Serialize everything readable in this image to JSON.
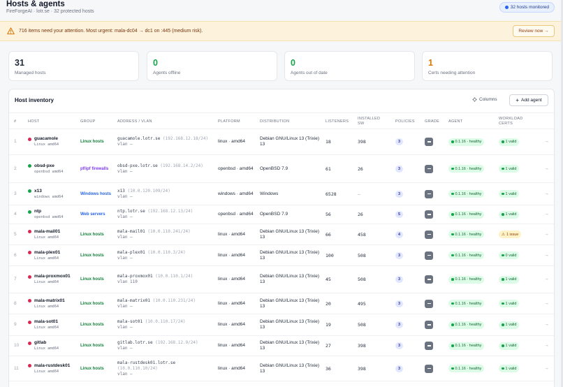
{
  "header": {
    "title": "Hosts & agents",
    "subtitle": "FireForgeAI · lotr.se · 32 protected hosts",
    "badge": "32 hosts monitored"
  },
  "alert": {
    "text": "716 items need your attention. Most urgent: mala-dc04 → dc1 on :445 (medium risk).",
    "button": "Review now →"
  },
  "stats": [
    {
      "value": "31",
      "label": "Managed hosts",
      "color": "#111827"
    },
    {
      "value": "0",
      "label": "Agents offline",
      "color": "#16a34a"
    },
    {
      "value": "0",
      "label": "Agents out of date",
      "color": "#16a34a"
    },
    {
      "value": "1",
      "label": "Certs needing attention",
      "color": "#d97706"
    }
  ],
  "table": {
    "title": "Host inventory",
    "columns_button": "Columns",
    "add_button": "Add agent",
    "headers": {
      "idx": "#",
      "host": "Host",
      "group": "Group",
      "address": "Address / VLAN",
      "platform": "Platform",
      "distribution": "Distribution",
      "listeners": "Listeners",
      "installed": "Installed SW",
      "policies": "Policies",
      "grade": "Grade",
      "agent": "Agent",
      "workload": "Workload certs"
    },
    "rows": [
      {
        "idx": "1",
        "name": "guacamole",
        "meta": "Linux amd64",
        "status": "red",
        "group": "Linux hosts",
        "group_color": "green",
        "fqdn": "guacamole.lotr.se",
        "ip": "(192.168.12.18/24)",
        "vlan": "vlan —",
        "platform": "linux · amd64",
        "dist": "Debian GNU/Linux 13 (Trixie) 13",
        "listeners": "18",
        "sw": "398",
        "policies": "3",
        "agent": "0.1.16 · healthy",
        "work": "1 valid",
        "work_kind": "valid"
      },
      {
        "idx": "2",
        "name": "obsd-pxe",
        "meta": "openbsd amd64",
        "status": "green",
        "group": "pf/ipf firewalls",
        "group_color": "purple",
        "fqdn": "obsd-pxe.lotr.se",
        "ip": "(192.168.14.2/24)",
        "vlan": "vlan —",
        "platform": "openbsd · amd64",
        "dist": "OpenBSD 7.9",
        "listeners": "61",
        "sw": "26",
        "policies": "3",
        "agent": "0.1.16 · healthy",
        "work": "1 valid",
        "work_kind": "valid"
      },
      {
        "idx": "3",
        "name": "x13",
        "meta": "windows amd64",
        "status": "green",
        "group": "Windows hosts",
        "group_color": "blue",
        "fqdn": "x13",
        "ip": "(10.0.120.109/24)",
        "vlan": "vlan —",
        "platform": "windows · amd64",
        "dist": "Windows",
        "listeners": "6528",
        "sw": "—",
        "policies": "3",
        "agent": "0.1.16 · healthy",
        "work": "1 valid",
        "work_kind": "valid"
      },
      {
        "idx": "4",
        "name": "ntp",
        "meta": "openbsd amd64",
        "status": "green",
        "group": "Web servers",
        "group_color": "blue",
        "fqdn": "ntp.lotr.se",
        "ip": "(192.168.12.13/24)",
        "vlan": "vlan —",
        "platform": "openbsd · amd64",
        "dist": "OpenBSD 7.9",
        "listeners": "56",
        "sw": "26",
        "policies": "5",
        "agent": "0.1.16 · healthy",
        "work": "1 valid",
        "work_kind": "valid"
      },
      {
        "idx": "5",
        "name": "mala-mail01",
        "meta": "Linux amd64",
        "status": "red",
        "group": "Linux hosts",
        "group_color": "green",
        "fqdn": "mala-mail01",
        "ip": "(10.0.110.241/24)",
        "vlan": "vlan —",
        "platform": "linux · amd64",
        "dist": "Debian GNU/Linux 13 (Trixie) 13",
        "listeners": "66",
        "sw": "458",
        "policies": "4",
        "agent": "0.1.16 · healthy",
        "work": "1 issue",
        "work_kind": "issue"
      },
      {
        "idx": "6",
        "name": "mala-plex01",
        "meta": "Linux amd64",
        "status": "red",
        "group": "Linux hosts",
        "group_color": "green",
        "fqdn": "mala-plex01",
        "ip": "(10.0.110.3/24)",
        "vlan": "vlan —",
        "platform": "linux · amd64",
        "dist": "Debian GNU/Linux 13 (Trixie) 13",
        "listeners": "100",
        "sw": "508",
        "policies": "3",
        "agent": "0.1.16 · healthy",
        "work": "0 valid",
        "work_kind": "valid"
      },
      {
        "idx": "7",
        "name": "mala-proxmox01",
        "meta": "Linux amd64",
        "status": "red",
        "group": "Linux hosts",
        "group_color": "green",
        "fqdn": "mala-proxmox01",
        "ip": "(10.0.110.1/24)",
        "vlan": "vlan 110",
        "platform": "linux · amd64",
        "dist": "Debian GNU/Linux 13 (Trixie) 13",
        "listeners": "45",
        "sw": "508",
        "policies": "3",
        "agent": "0.1.16 · healthy",
        "work": "1 valid",
        "work_kind": "valid"
      },
      {
        "idx": "8",
        "name": "mala-matrix01",
        "meta": "Linux amd64",
        "status": "red",
        "group": "Linux hosts",
        "group_color": "green",
        "fqdn": "mala-matrix01",
        "ip": "(10.0.110.231/24)",
        "vlan": "vlan —",
        "platform": "linux · amd64",
        "dist": "Debian GNU/Linux 13 (Trixie) 13",
        "listeners": "20",
        "sw": "495",
        "policies": "3",
        "agent": "0.1.16 · healthy",
        "work": "1 valid",
        "work_kind": "valid"
      },
      {
        "idx": "9",
        "name": "mala-sot01",
        "meta": "Linux amd64",
        "status": "red",
        "group": "Linux hosts",
        "group_color": "green",
        "fqdn": "mala-sot01",
        "ip": "(10.0.110.17/24)",
        "vlan": "vlan —",
        "platform": "linux · amd64",
        "dist": "Debian GNU/Linux 13 (Trixie) 13",
        "listeners": "19",
        "sw": "508",
        "policies": "3",
        "agent": "0.1.16 · healthy",
        "work": "1 valid",
        "work_kind": "valid"
      },
      {
        "idx": "10",
        "name": "gitlab",
        "meta": "Linux amd64",
        "status": "red",
        "group": "Linux hosts",
        "group_color": "green",
        "fqdn": "gitlab.lotr.se",
        "ip": "(192.168.12.9/24)",
        "vlan": "vlan —",
        "platform": "linux · amd64",
        "dist": "Debian GNU/Linux 13 (Trixie) 13",
        "listeners": "27",
        "sw": "398",
        "policies": "3",
        "agent": "0.1.16 · healthy",
        "work": "1 valid",
        "work_kind": "valid"
      },
      {
        "idx": "11",
        "name": "mala-rustdesk01",
        "meta": "Linux amd64",
        "status": "red",
        "group": "Linux hosts",
        "group_color": "green",
        "fqdn": "mala-rustdesk01.lotr.se",
        "ip": "(10.0.110.10/24)",
        "vlan": "vlan —",
        "platform": "linux · amd64",
        "dist": "Debian GNU/Linux 13 (Trixie) 13",
        "listeners": "36",
        "sw": "398",
        "policies": "3",
        "agent": "0.1.16 · healthy",
        "work": "1 valid",
        "work_kind": "valid"
      }
    ]
  }
}
